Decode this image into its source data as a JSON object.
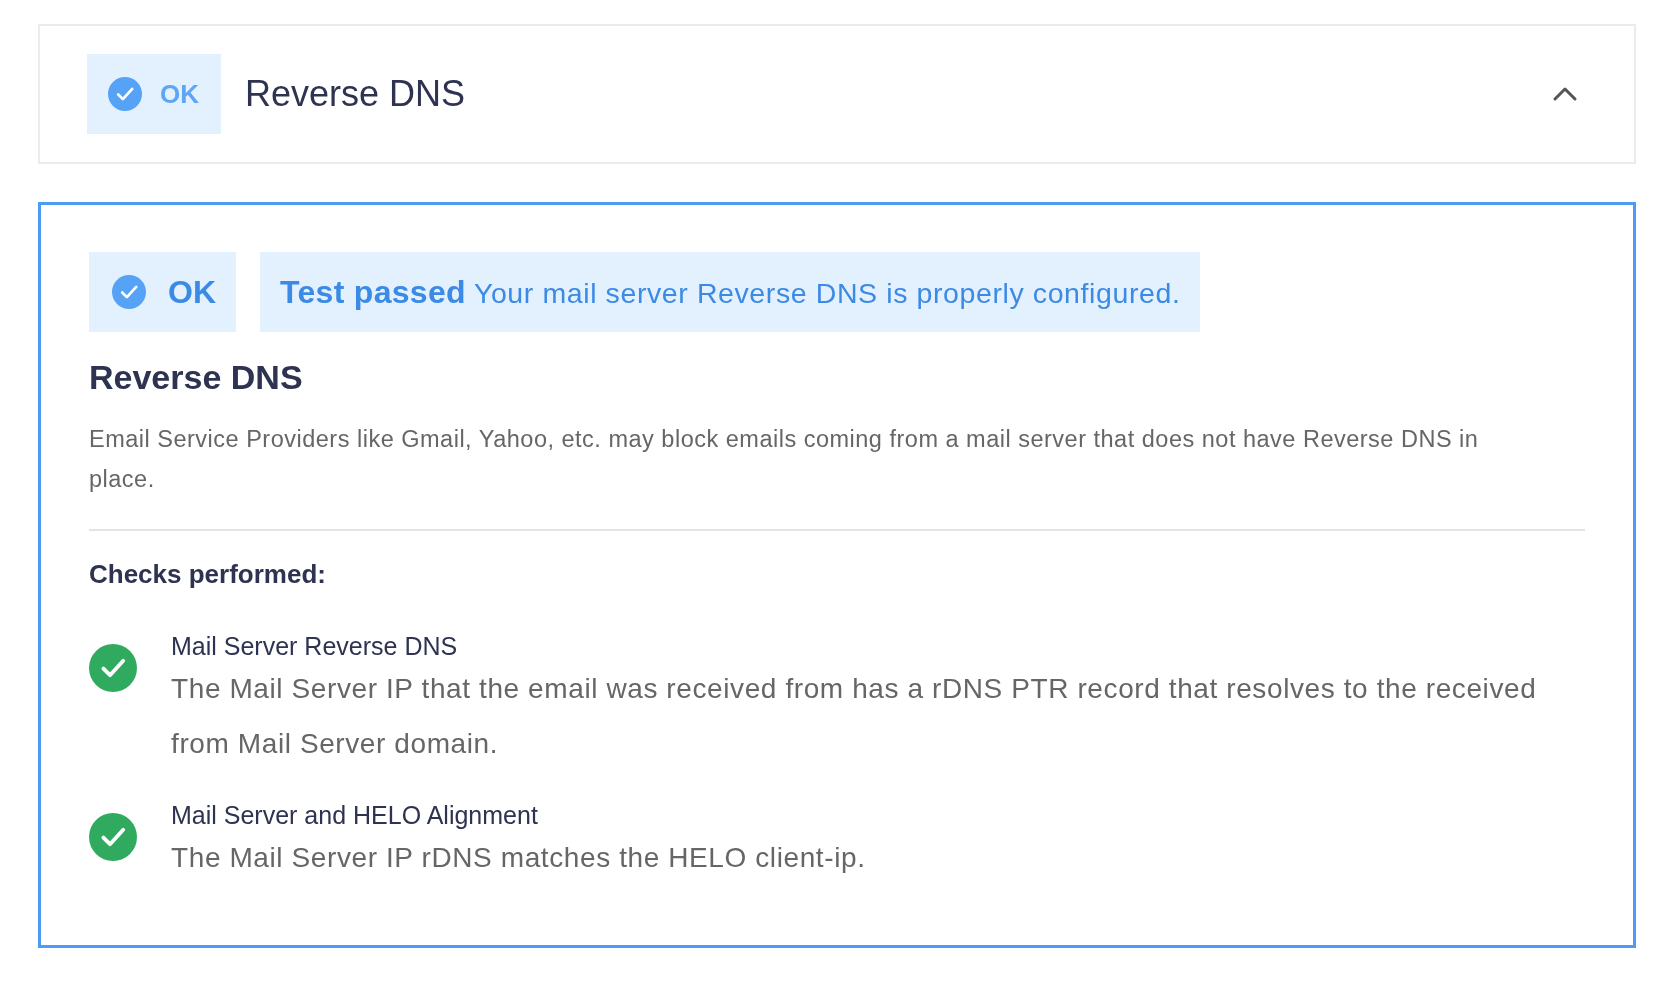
{
  "header": {
    "kind": "success",
    "badge": "OK",
    "title": "Reverse DNS",
    "expanded": true
  },
  "result": {
    "kind": "success",
    "badge": "OK",
    "message": "**Test passed** Your mail server Reverse DNS is properly configured.",
    "heading": "Reverse DNS",
    "description": "Email Service Providers like Gmail, Yahoo, etc. may block emails coming from a mail server that does not have Reverse DNS in place.",
    "checks_title": "Checks performed:",
    "checks": [
      {
        "passed": true,
        "title": "Mail Server Reverse DNS",
        "detail": "The Mail Server IP that the email was received from has a rDNS PTR record that resolves to the received from Mail Server domain."
      },
      {
        "passed": true,
        "title": "Mail Server and HELO Alignment",
        "detail": "The Mail Server IP rDNS matches the HELO client-ip."
      }
    ]
  }
}
